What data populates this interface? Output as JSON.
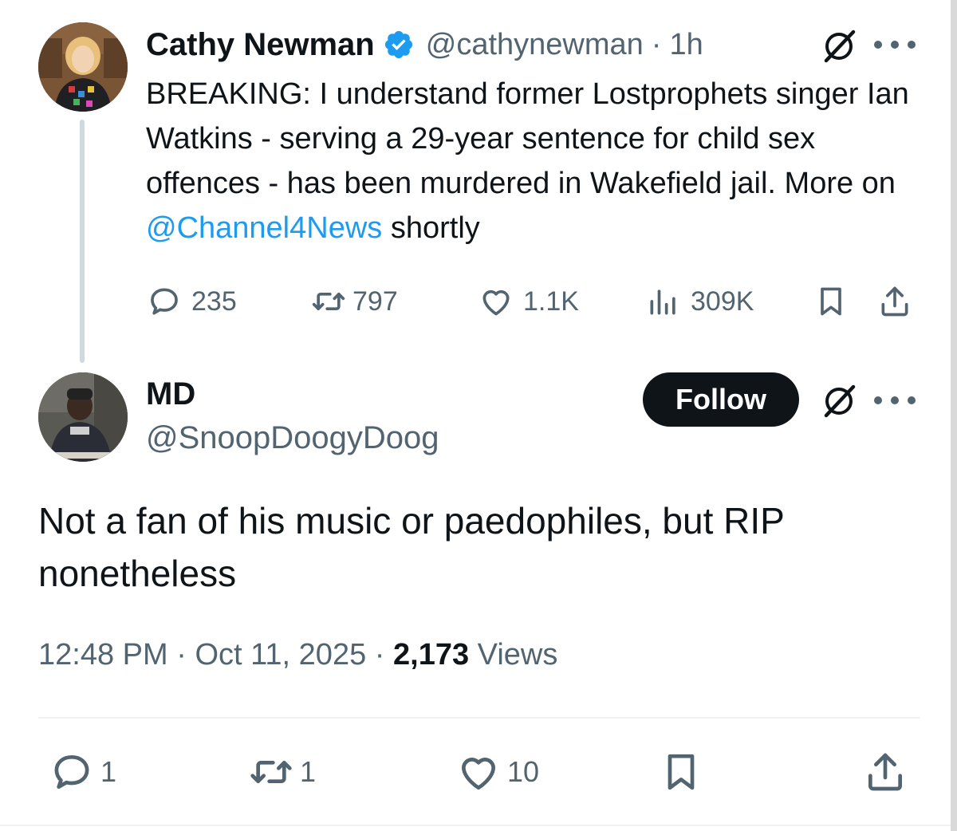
{
  "parent_tweet": {
    "author_name": "Cathy Newman",
    "handle": "@cathynewman",
    "separator": "·",
    "time": "1h",
    "text_before": "BREAKING: I understand former Lostprophets singer Ian Watkins - serving a 29-year sentence for child sex offences - has been murdered in Wakefield jail. More on ",
    "mention": "@Channel4News",
    "text_after": " shortly",
    "stats": {
      "replies": "235",
      "reposts": "797",
      "likes": "1.1K",
      "views": "309K"
    }
  },
  "main_tweet": {
    "author_name": "MD",
    "handle": "@SnoopDoogyDoog",
    "follow_label": "Follow",
    "text": "Not a fan of his music or paedophiles, but RIP nonetheless",
    "time": "12:48 PM",
    "sep1": "·",
    "date": "Oct 11, 2025",
    "sep2": "·",
    "views_count": "2,173",
    "views_label": "Views",
    "stats": {
      "replies": "1",
      "reposts": "1",
      "likes": "10"
    }
  },
  "icons": {
    "verified": "verified-badge-icon",
    "grok": "grok-icon",
    "more": "more-icon",
    "reply": "reply-icon",
    "repost": "repost-icon",
    "like": "heart-icon",
    "views": "views-icon",
    "bookmark": "bookmark-icon",
    "share": "share-icon"
  },
  "colors": {
    "text": "#0f1419",
    "secondary": "#536471",
    "link": "#1d9bf0",
    "verified": "#1d9bf0",
    "follow_bg": "#0f1419"
  }
}
